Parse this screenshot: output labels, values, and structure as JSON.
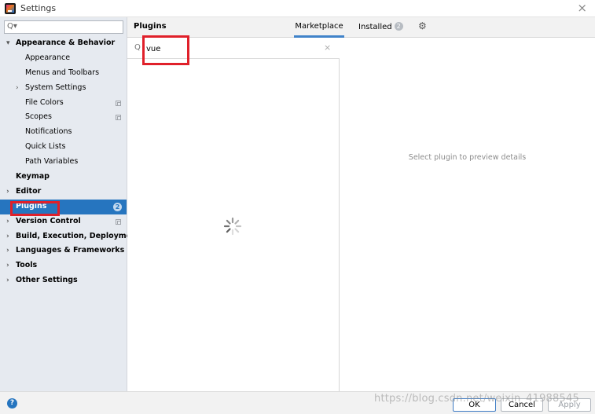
{
  "window": {
    "title": "Settings",
    "close_glyph": "×"
  },
  "sidebar": {
    "search_placeholder": "",
    "search_glyph": "Q▾",
    "items": [
      {
        "label": "Appearance & Behavior",
        "bold": true,
        "expanded": true,
        "arrow": "▾"
      },
      {
        "label": "Appearance"
      },
      {
        "label": "Menus and Toolbars"
      },
      {
        "label": "System Settings",
        "arrow": "›"
      },
      {
        "label": "File Colors"
      },
      {
        "label": "Scopes"
      },
      {
        "label": "Notifications"
      },
      {
        "label": "Quick Lists"
      },
      {
        "label": "Path Variables"
      },
      {
        "label": "Keymap"
      },
      {
        "label": "Editor",
        "arrow": "›"
      },
      {
        "label": "Plugins",
        "badge": "2"
      },
      {
        "label": "Version Control",
        "arrow": "›"
      },
      {
        "label": "Build, Execution, Deployment",
        "arrow": "›"
      },
      {
        "label": "Languages & Frameworks",
        "arrow": "›"
      },
      {
        "label": "Tools",
        "arrow": "›"
      },
      {
        "label": "Other Settings",
        "arrow": "›"
      }
    ]
  },
  "header": {
    "title": "Plugins",
    "tabs": [
      {
        "label": "Marketplace",
        "active": true
      },
      {
        "label": "Installed",
        "badge": "2"
      }
    ],
    "settings_glyph": "⚙"
  },
  "plugin_search": {
    "value": "vue",
    "search_glyph": "Q",
    "clear_glyph": "×"
  },
  "details": {
    "empty_text": "Select plugin to preview details"
  },
  "footer": {
    "help_glyph": "?",
    "ok_label": "OK",
    "cancel_label": "Cancel",
    "apply_label": "Apply"
  },
  "watermark": "https://blog.csdn.net/weixin_41988545",
  "colors": {
    "selection": "#2675bf",
    "annotation_red": "#e0202a",
    "tab_underline": "#4083c9",
    "sidebar_bg": "#e6eaf0"
  }
}
